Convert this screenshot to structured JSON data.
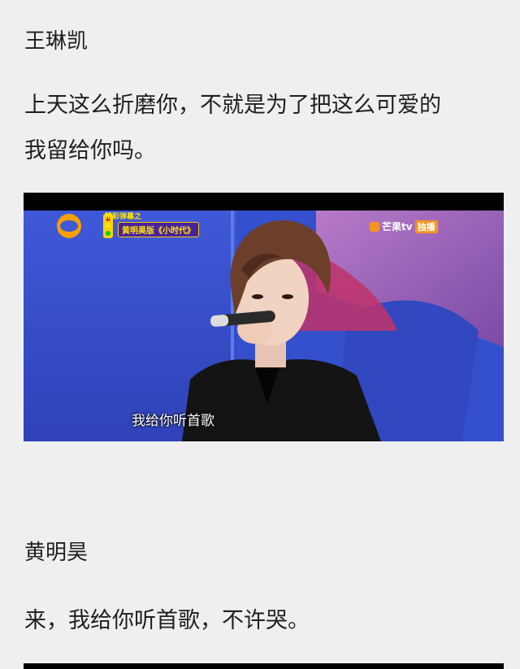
{
  "posts": [
    {
      "name": "王琳凯",
      "quote_line1": "上天这么折磨你，不就是为了把这么可爱的",
      "quote_line2": "我留给你吗。"
    },
    {
      "name": "黄明昊",
      "quote": "来，我给你听首歌，不许哭。"
    }
  ],
  "video": {
    "caption": "我给你听首歌",
    "brand": "芒果tv",
    "brand_tag": "独播",
    "program_tag": "精彩弹幕之",
    "program_title": "黄明昊版《小时代》"
  },
  "colors": {
    "background": "#efefef",
    "text": "#1f1f1f",
    "studio_blue": "#3a4fd0",
    "studio_purple": "#9a5fb8"
  }
}
